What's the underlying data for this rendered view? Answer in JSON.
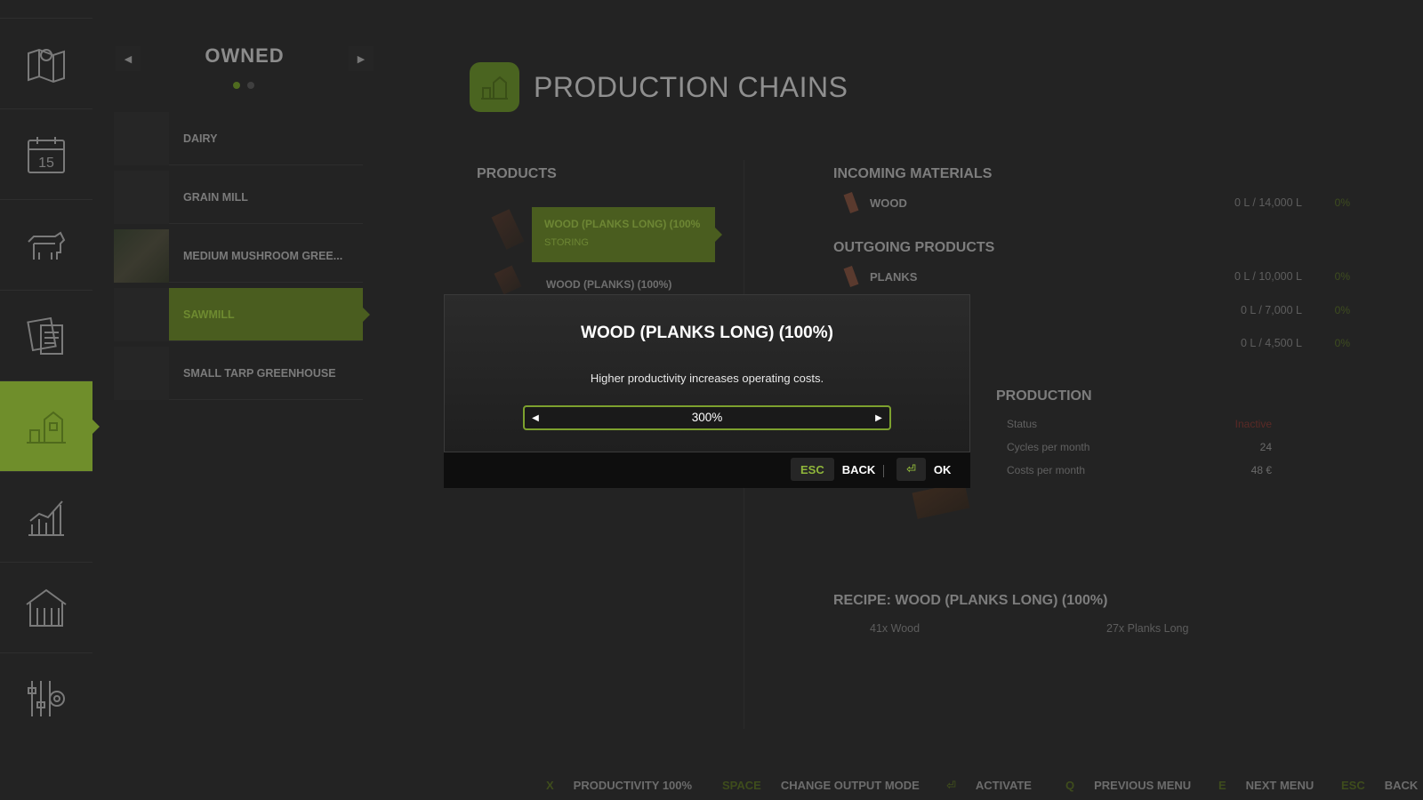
{
  "sidebar": {
    "items": [
      {
        "icon": "map-icon"
      },
      {
        "icon": "calendar-icon",
        "label": "15"
      },
      {
        "icon": "cow-icon"
      },
      {
        "icon": "documents-icon"
      },
      {
        "icon": "production-icon",
        "active": true
      },
      {
        "icon": "chart-icon"
      },
      {
        "icon": "barn-icon"
      },
      {
        "icon": "settings-icon"
      }
    ]
  },
  "owned": {
    "title": "OWNED",
    "prev": "◀",
    "next": "▶",
    "items": [
      {
        "label": "DAIRY"
      },
      {
        "label": "GRAIN MILL"
      },
      {
        "label": "MEDIUM MUSHROOM GREE..."
      },
      {
        "label": "SAWMILL",
        "active": true
      },
      {
        "label": "SMALL TARP GREENHOUSE"
      }
    ]
  },
  "main": {
    "title": "PRODUCTION CHAINS",
    "products_title": "PRODUCTS",
    "products": [
      {
        "name": "WOOD (PLANKS LONG) (100%",
        "status": "STORING"
      },
      {
        "name": "WOOD (PLANKS) (100%)"
      }
    ],
    "incoming_title": "INCOMING MATERIALS",
    "incoming": [
      {
        "name": "WOOD",
        "value": "0 L / 14,000 L",
        "pct": "0%"
      }
    ],
    "outgoing_title": "OUTGOING PRODUCTS",
    "outgoing": [
      {
        "name": "PLANKS",
        "value": "0 L / 10,000 L",
        "pct": "0%"
      },
      {
        "name": "",
        "value": "0 L / 7,000 L",
        "pct": "0%"
      },
      {
        "name": "",
        "value": "0 L / 4,500 L",
        "pct": "0%"
      }
    ],
    "production_title": "PRODUCTION",
    "production": [
      {
        "label": "Status",
        "value": "Inactive"
      },
      {
        "label": "Cycles per month",
        "value": "24"
      },
      {
        "label": "Costs per month",
        "value": "48 €"
      }
    ],
    "recipe_title": "RECIPE: WOOD (PLANKS LONG) (100%)",
    "recipe_input": "41x Wood",
    "recipe_output": "27x Planks Long"
  },
  "hints": [
    {
      "key": "X",
      "label": "PRODUCTIVITY 100%"
    },
    {
      "key": "SPACE",
      "label": "CHANGE OUTPUT MODE"
    },
    {
      "key": "⏎",
      "label": "ACTIVATE"
    },
    {
      "key": "Q",
      "label": "PREVIOUS MENU"
    },
    {
      "key": "E",
      "label": "NEXT MENU"
    },
    {
      "key": "ESC",
      "label": "BACK"
    }
  ],
  "dialog": {
    "title": "WOOD (PLANKS LONG) (100%)",
    "text": "Higher productivity increases operating costs.",
    "value": "300%",
    "left": "◀",
    "right": "▶",
    "back_key": "ESC",
    "back_label": "BACK",
    "ok_key": "⏎",
    "ok_label": "OK"
  },
  "colors": {
    "accent": "#7da12e",
    "accent_text": "#8fb63a",
    "active_panel": "#6f8e2b"
  }
}
